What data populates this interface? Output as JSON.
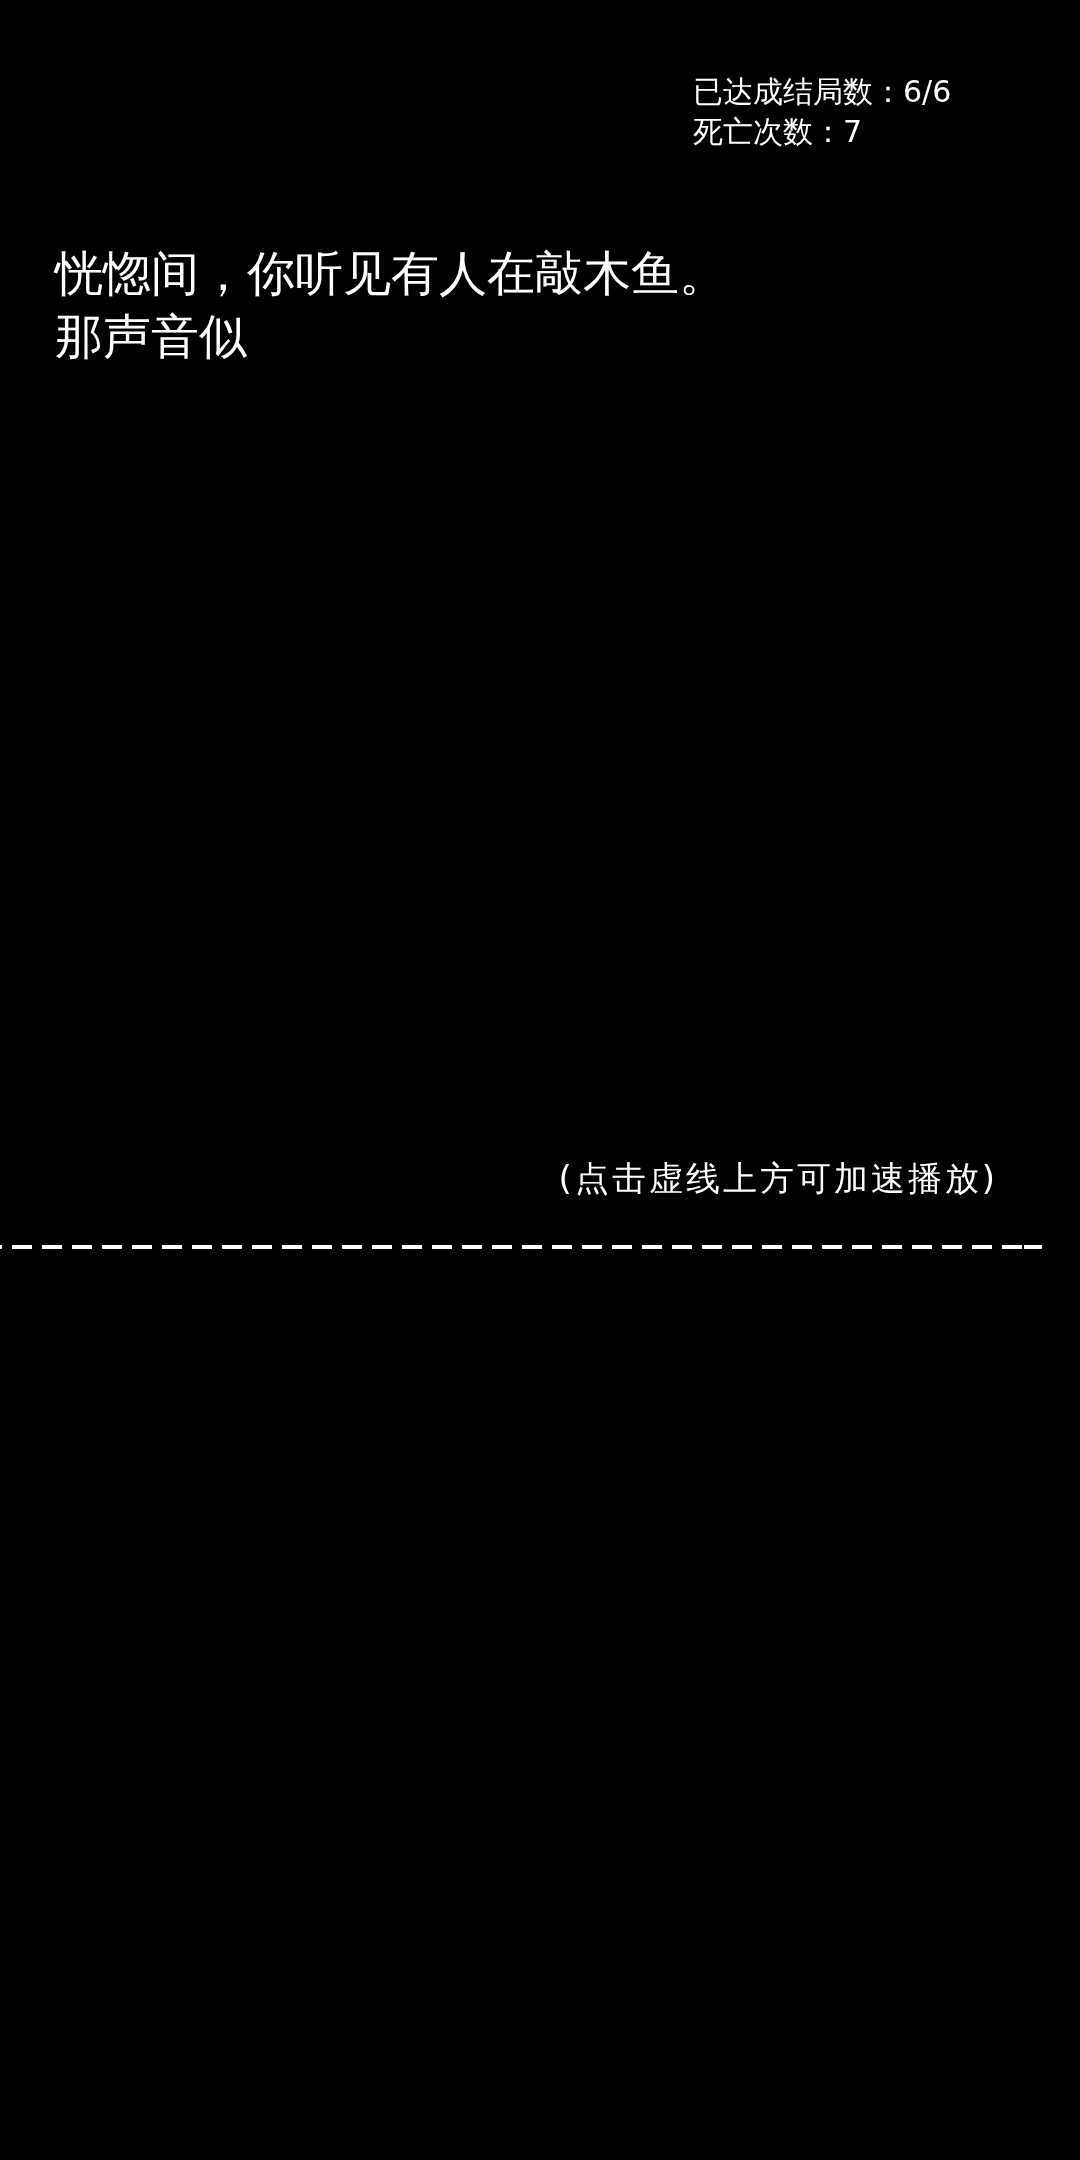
{
  "stats": [
    "已达成结局数：6/6",
    "死亡次数：7"
  ],
  "story": {
    "lines": [
      "恍惚间，你听见有人在敲木鱼。",
      "那声音似"
    ]
  },
  "hint": "(点击虚线上方可加速播放)"
}
